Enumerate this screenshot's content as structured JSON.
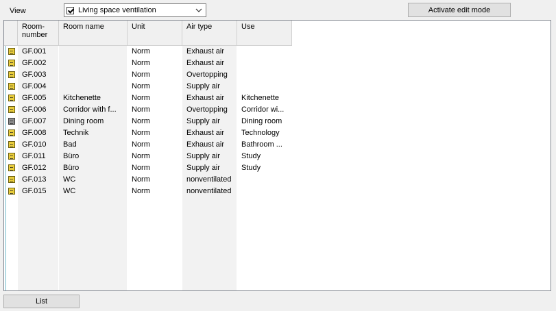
{
  "view": {
    "label": "View",
    "selected": "Living space ventilation"
  },
  "toolbar": {
    "edit_label": "Activate edit mode",
    "list_label": "List"
  },
  "table": {
    "headers": {
      "number": "Room-\nnumber",
      "name": "Room name",
      "unit": "Unit",
      "air_type": "Air type",
      "use": "Use"
    },
    "rows": [
      {
        "icon": "room-icon",
        "number": "GF.001",
        "name": "",
        "unit": "Norm",
        "air_type": "Exhaust air",
        "use": ""
      },
      {
        "icon": "room-icon",
        "number": "GF.002",
        "name": "",
        "unit": "Norm",
        "air_type": "Exhaust air",
        "use": ""
      },
      {
        "icon": "room-icon",
        "number": "GF.003",
        "name": "",
        "unit": "Norm",
        "air_type": "Overtopping",
        "use": ""
      },
      {
        "icon": "room-icon",
        "number": "GF.004",
        "name": "",
        "unit": "Norm",
        "air_type": "Supply air",
        "use": ""
      },
      {
        "icon": "room-icon",
        "number": "GF.005",
        "name": "Kitchenette",
        "unit": "Norm",
        "air_type": "Exhaust air",
        "use": "Kitchenette"
      },
      {
        "icon": "room-icon",
        "number": "GF.006",
        "name": "Corridor with f...",
        "unit": "Norm",
        "air_type": "Overtopping",
        "use": "Corridor wi..."
      },
      {
        "icon": "room-icon-dark",
        "number": "GF.007",
        "name": "Dining room",
        "unit": "Norm",
        "air_type": "Supply air",
        "use": "Dining room"
      },
      {
        "icon": "room-icon",
        "number": "GF.008",
        "name": "Technik",
        "unit": "Norm",
        "air_type": "Exhaust air",
        "use": "Technology"
      },
      {
        "icon": "room-icon",
        "number": "GF.010",
        "name": "Bad",
        "unit": "Norm",
        "air_type": "Exhaust air",
        "use": "Bathroom ..."
      },
      {
        "icon": "room-icon",
        "number": "GF.011",
        "name": "Büro",
        "unit": "Norm",
        "air_type": "Supply air",
        "use": "Study"
      },
      {
        "icon": "room-icon",
        "number": "GF.012",
        "name": "Büro",
        "unit": "Norm",
        "air_type": "Supply air",
        "use": "Study"
      },
      {
        "icon": "room-icon",
        "number": "GF.013",
        "name": "WC",
        "unit": "Norm",
        "air_type": "nonventilated",
        "use": ""
      },
      {
        "icon": "room-icon",
        "number": "GF.015",
        "name": "WC",
        "unit": "Norm",
        "air_type": "nonventilated",
        "use": ""
      }
    ]
  },
  "colors": {
    "room_icon": "#e8cc3c",
    "room_icon_dark": "#8c8c8c",
    "grid_edge": "#6fb8c9"
  }
}
